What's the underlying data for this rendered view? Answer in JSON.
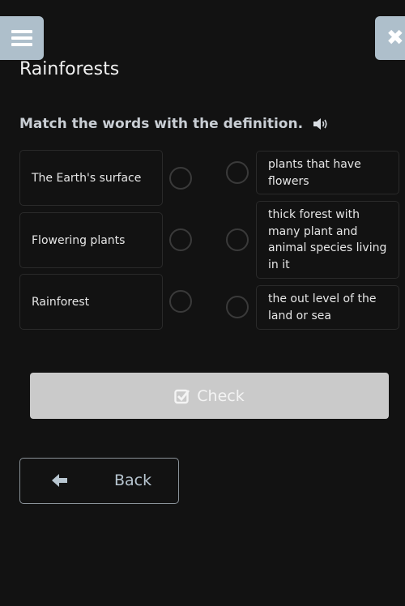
{
  "header": {
    "menu_icon": "hamburger-menu-icon",
    "close_icon": "close-x-icon",
    "close_glyph": "✖",
    "title": "Rainforests"
  },
  "exercise": {
    "instruction": "Match the words with the definition.",
    "audio_icon": "speaker-icon",
    "words": [
      {
        "label": "The Earth's surface"
      },
      {
        "label": "Flowering plants"
      },
      {
        "label": "Rainforest"
      }
    ],
    "definitions": [
      {
        "label": "plants that have flowers"
      },
      {
        "label": "thick forest with many plant and animal species living in it"
      },
      {
        "label": "the out level of the land or sea"
      }
    ]
  },
  "actions": {
    "check_label": "Check",
    "check_icon": "checkbox-checked-icon",
    "back_label": "Back",
    "back_icon": "arrow-left-icon"
  },
  "colors": {
    "background": "#121212",
    "header_button": "#aebfcb",
    "check_button": "#cacaca",
    "back_text": "#b8c6d1"
  }
}
